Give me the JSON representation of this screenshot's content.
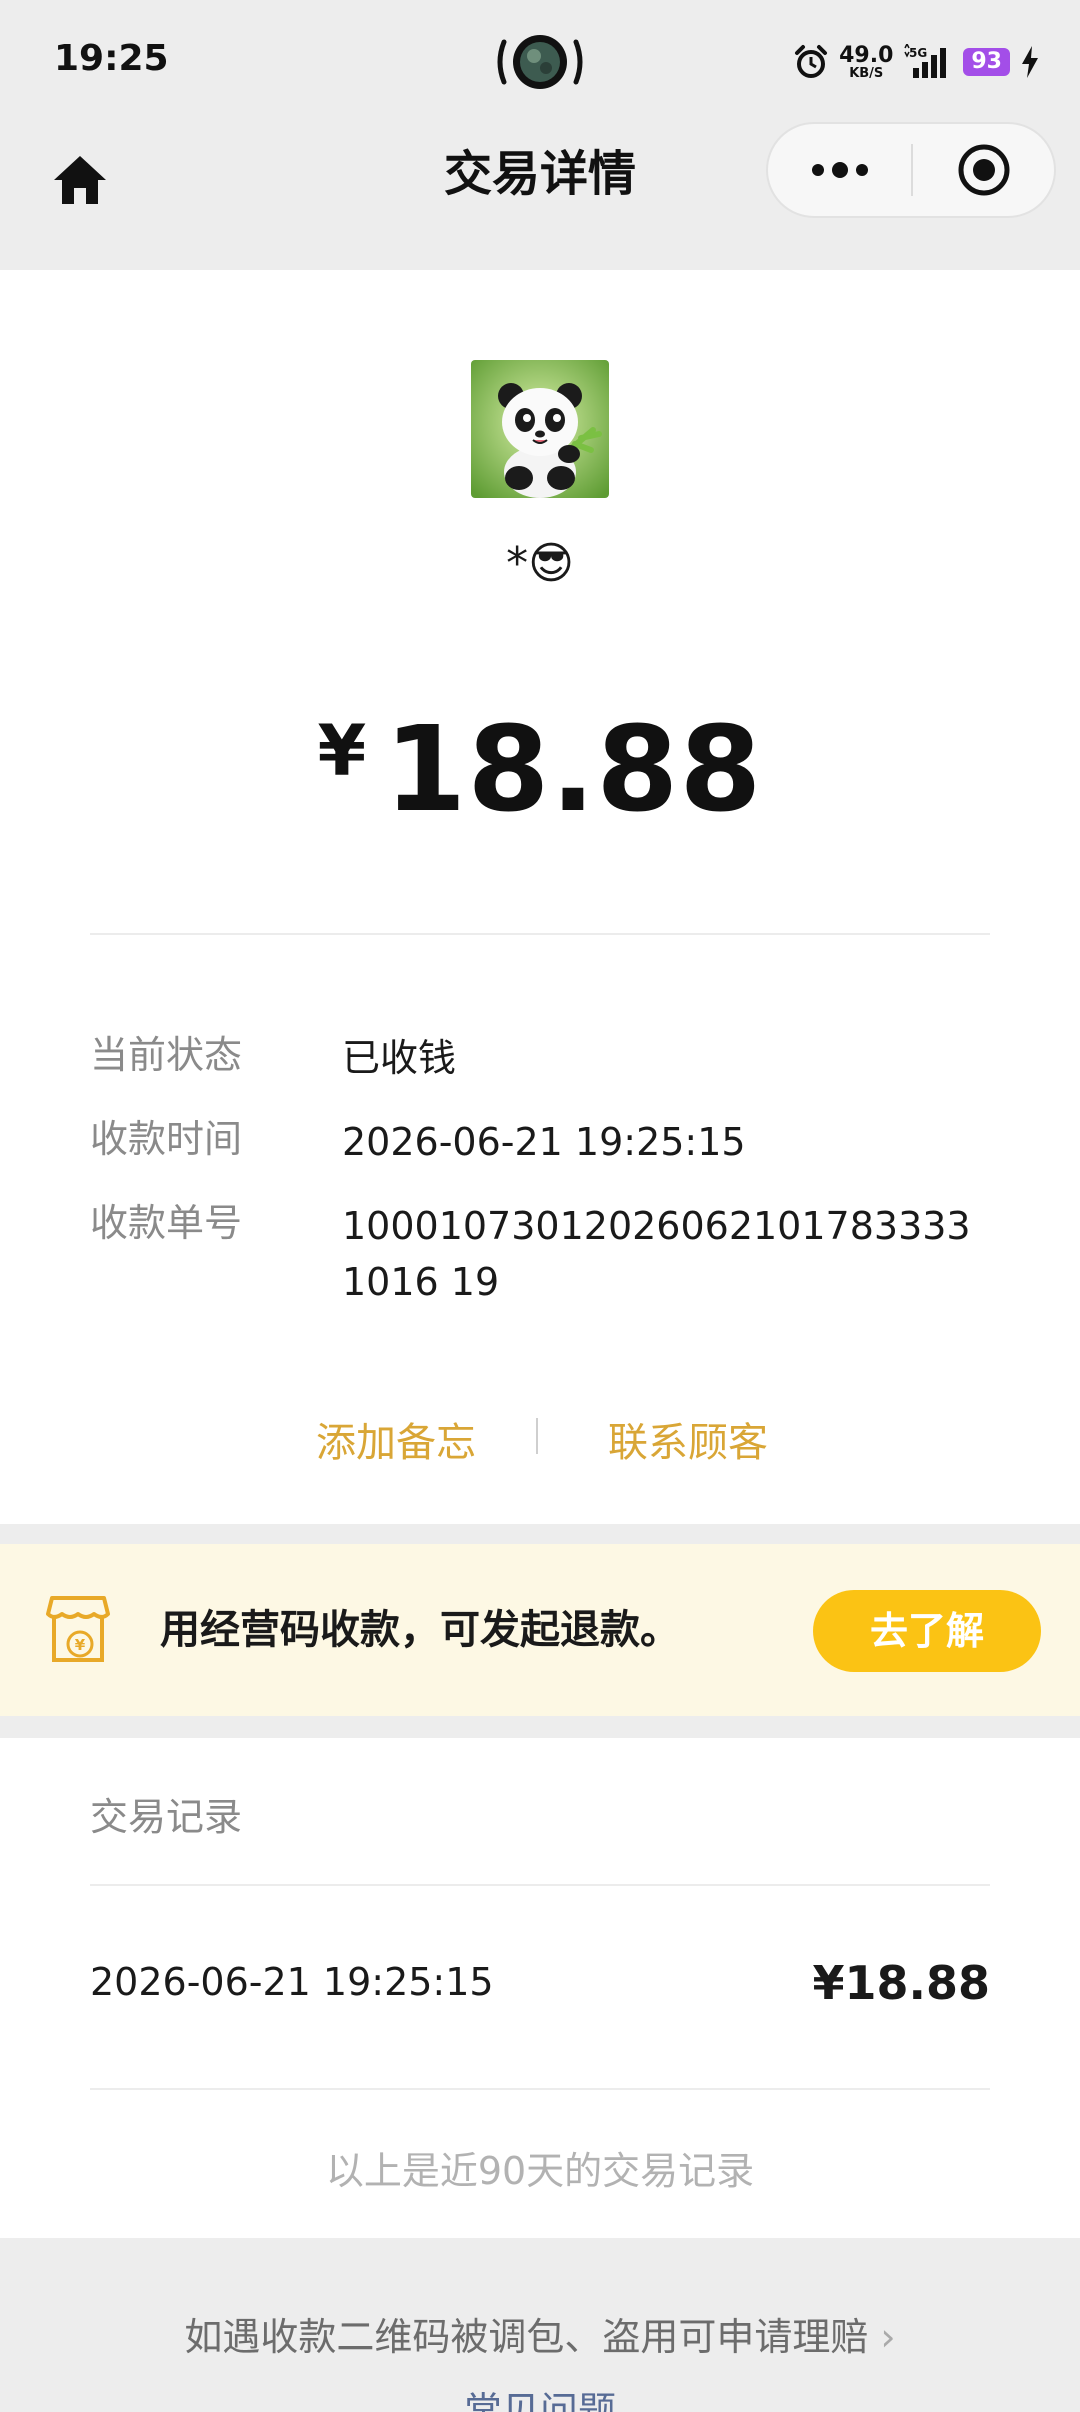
{
  "status_bar": {
    "time": "19:25",
    "net_speed": "49.0",
    "net_unit": "KB/S",
    "network": "5G",
    "battery": "93"
  },
  "nav": {
    "title": "交易详情",
    "home_icon": "home-icon",
    "more_icon": "more-dots-icon",
    "close_icon": "target-close-icon"
  },
  "payer": {
    "nickname": "*😎"
  },
  "amount": {
    "currency": "¥",
    "value": "18.88"
  },
  "details": [
    {
      "label": "当前状态",
      "value": "已收钱"
    },
    {
      "label": "收款时间",
      "value": "2026-06-21 19:25:15"
    },
    {
      "label": "收款单号",
      "value": "100010730120260621017833331016 19"
    }
  ],
  "actions": {
    "remark": "添加备忘",
    "separator": "|",
    "contact": "联系顾客"
  },
  "banner": {
    "text": "用经营码收款，可发起退款。",
    "button": "去了解"
  },
  "records": {
    "title": "交易记录",
    "items": [
      {
        "time": "2026-06-21 19:25:15",
        "amount": "¥18.88"
      }
    ],
    "footer": "以上是近90天的交易记录"
  },
  "footer": {
    "claim": "如遇收款二维码被调包、盗用可申请理赔",
    "claim_chevron": "›",
    "faq": "常见问题"
  },
  "colors": {
    "accent_gold": "#d9a636",
    "button_yellow": "#fbc314",
    "banner_bg": "#fdf8e4",
    "link_blue": "#576b95",
    "battery_purple": "#a34ee8"
  }
}
